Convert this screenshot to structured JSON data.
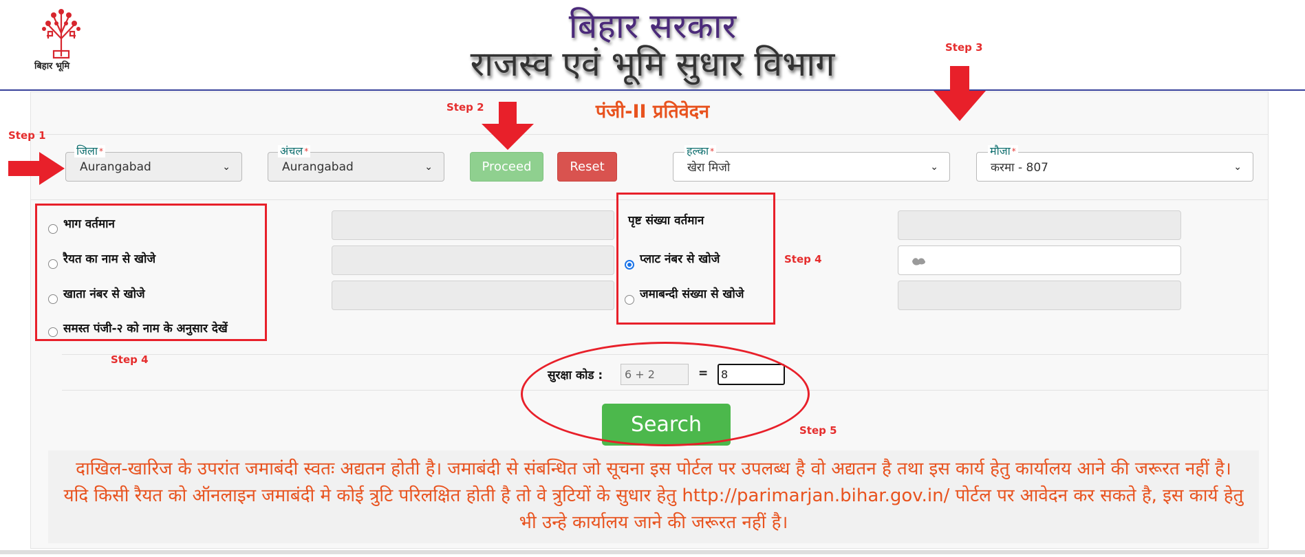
{
  "header": {
    "logo_text": "बिहार भूमि",
    "title_line1": "बिहार सरकार",
    "title_line2": "राजस्व एवं भूमि सुधार विभाग"
  },
  "form": {
    "title": "पंजी-II प्रतिवेदन",
    "district": {
      "label": "जिला",
      "required": "*",
      "value": "Aurangabad"
    },
    "circle": {
      "label": "अंचल",
      "required": "*",
      "value": "Aurangabad"
    },
    "halka": {
      "label": "हल्का",
      "required": "*",
      "value": "खेरा मिजो"
    },
    "mauza": {
      "label": "मौजा",
      "required": "*",
      "value": "करमा - 807"
    },
    "proceed_label": "Proceed",
    "reset_label": "Reset",
    "left_options": [
      {
        "label": "भाग वर्तमान",
        "checked": false
      },
      {
        "label": "रैयत का नाम से खोजे",
        "checked": false
      },
      {
        "label": "खाता नंबर से खोजे",
        "checked": false
      },
      {
        "label": "समस्त पंजी-२ को नाम के अनुसार देखें",
        "checked": false
      }
    ],
    "right_options": [
      {
        "label": "पृष्ट संख्या वर्तमान",
        "checked": false
      },
      {
        "label": "प्लाट नंबर से खोजे",
        "checked": true
      },
      {
        "label": "जमाबन्दी संख्या से खोजे",
        "checked": false
      }
    ],
    "captcha": {
      "label": "सुरक्षा कोड :",
      "question": "6 + 2",
      "equals": "=",
      "answer": "8"
    },
    "search_label": "Search"
  },
  "notice": {
    "text": "दाखिल-खारिज के उपरांत जमाबंदी स्वतः अद्यतन होती है। जमाबंदी से संबन्धित जो सूचना इस पोर्टल पर उपलब्ध है वो अद्यतन है तथा इस कार्य हेतु कार्यालय आने की जरूरत नहीं है। यदि किसी रैयत को ऑनलाइन जमाबंदी मे कोई त्रुटि परिलक्षित होती है तो वे त्रुटियों के सुधार हेतु http://parimarjan.bihar.gov.in/ पोर्टल पर आवेदन कर सकते है, इस कार्य हेतु भी उन्हे कार्यालय जाने की जरूरत नहीं है।"
  },
  "annotations": {
    "step1": "Step 1",
    "step2": "Step 2",
    "step3": "Step 3",
    "step4_left": "Step 4",
    "step4_right": "Step 4",
    "step5": "Step 5"
  },
  "colors": {
    "annotation_red": "#e8202a",
    "accent_orange": "#e8531f",
    "search_green": "#4cb84c",
    "header_purple": "#4b2a7a"
  }
}
